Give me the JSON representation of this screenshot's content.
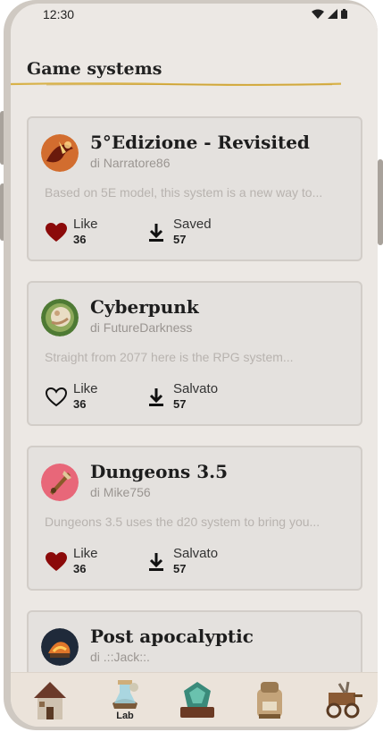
{
  "status_bar": {
    "time": "12:30"
  },
  "page": {
    "title": "Game systems"
  },
  "cards": [
    {
      "title": "5°Edizione - Revisited",
      "author": "di Narratore86",
      "description": "Based on 5E model, this system is a new way to...",
      "like_label": "Like",
      "like_count": "36",
      "liked": true,
      "save_label": "Saved",
      "save_count": "57"
    },
    {
      "title": "Cyberpunk",
      "author": "di FutureDarkness",
      "description": "Straight from 2077 here is the RPG system...",
      "like_label": "Like",
      "like_count": "36",
      "liked": false,
      "save_label": "Salvato",
      "save_count": "57"
    },
    {
      "title": "Dungeons 3.5",
      "author": "di Mike756",
      "description": "Dungeons 3.5 uses the d20 system to bring you...",
      "like_label": "Like",
      "like_count": "36",
      "liked": true,
      "save_label": "Salvato",
      "save_count": "57"
    },
    {
      "title": "Post apocalyptic",
      "author": "di .::Jack::."
    }
  ],
  "bottom_nav": {
    "items": [
      {
        "icon": "house-icon"
      },
      {
        "icon": "lab-icon",
        "label": "Lab"
      },
      {
        "icon": "dice-book-icon"
      },
      {
        "icon": "backpack-icon"
      },
      {
        "icon": "cart-icon"
      }
    ]
  },
  "colors": {
    "heart": "#8b0a0a",
    "accent_line": "#d8b24a",
    "background": "#ece8e4"
  }
}
